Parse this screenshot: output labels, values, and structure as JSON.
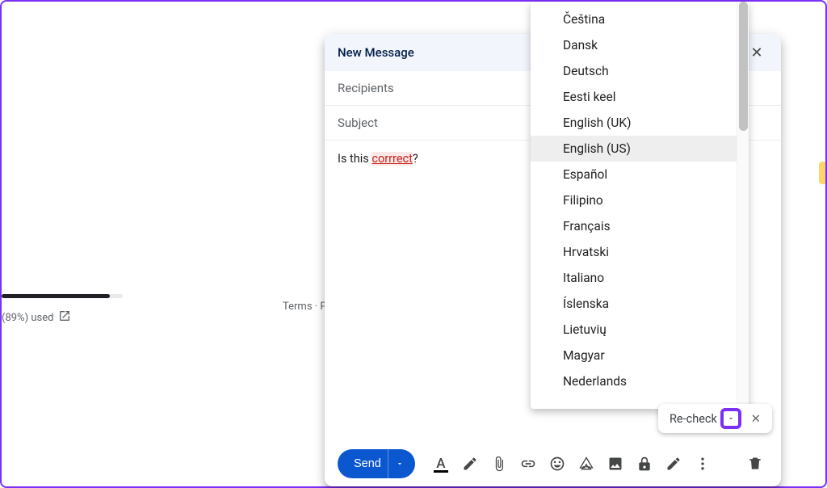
{
  "storage": {
    "used_label": "(89%) used",
    "percent": 89
  },
  "footer": {
    "terms": "Terms",
    "sep": " · ",
    "privacy_truncated": "Priva"
  },
  "compose": {
    "title": "New Message",
    "recipients_placeholder": "Recipients",
    "subject_placeholder": "Subject",
    "body_prefix": "Is this ",
    "body_error_word": "corrrect",
    "body_suffix": "?",
    "send_label": "Send"
  },
  "recheck": {
    "label": "Re-check"
  },
  "languages": {
    "selected_index": 4,
    "items": [
      "Čeština",
      "Dansk",
      "Deutsch",
      "Eesti keel",
      "English (UK)",
      "English (US)",
      "Español",
      "Filipino",
      "Français",
      "Hrvatski",
      "Italiano",
      "Íslenska",
      "Lietuvių",
      "Magyar",
      "Nederlands"
    ]
  }
}
